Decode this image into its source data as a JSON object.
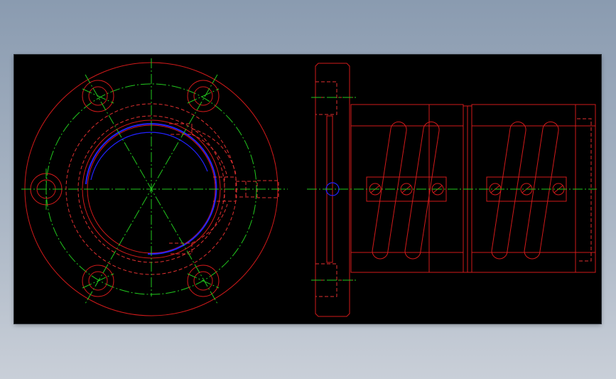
{
  "drawing": {
    "background": "#000000",
    "colors": {
      "outline": "#d11a1a",
      "hidden": "#e03030",
      "centerline": "#22c81e",
      "highlight": "#2222ff"
    }
  },
  "views": [
    {
      "name": "front-view-flange"
    },
    {
      "name": "side-view-ball-nut"
    }
  ]
}
